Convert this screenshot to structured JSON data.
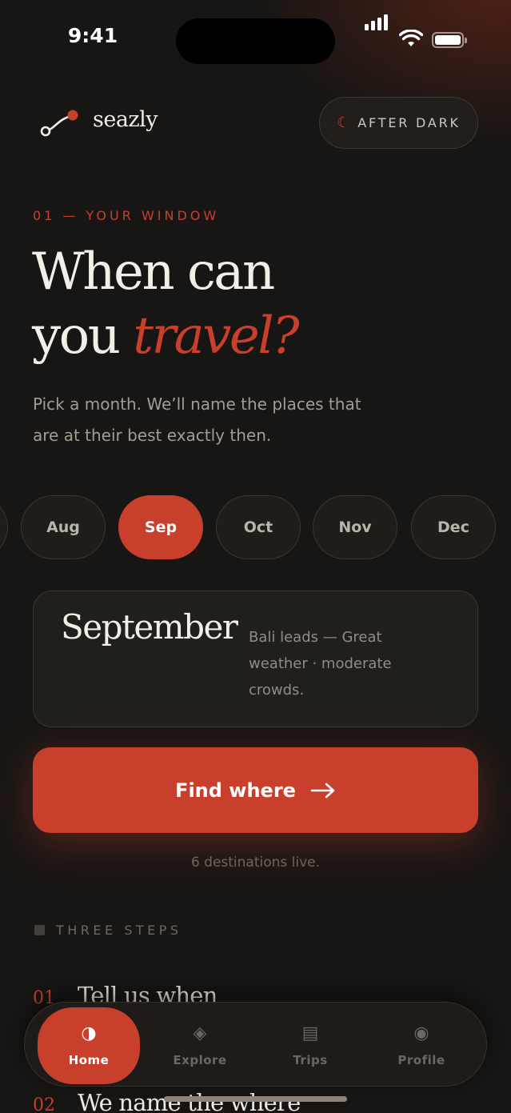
{
  "status": {
    "time": "9:41"
  },
  "header": {
    "brand": "seazly",
    "mode_toggle": {
      "icon": "moon-icon",
      "label": "AFTER DARK"
    }
  },
  "hero": {
    "eyebrow": "01 — YOUR WINDOW",
    "title_line1": "When can",
    "title_line2_plain": "you ",
    "title_line2_accent": "travel?",
    "subtitle": "Pick a month. We’ll name the places that are at their best exactly then."
  },
  "months": {
    "items": [
      "Aug",
      "Sep",
      "Oct",
      "Nov",
      "Dec"
    ],
    "selected": "Sep"
  },
  "selection_card": {
    "month_name": "September",
    "note": "Bali leads — Great weather · moderate crowds."
  },
  "cta": {
    "label": "Find where",
    "icon": "arrow-right-icon"
  },
  "live_count": "6 destinations live.",
  "steps": {
    "heading": "THREE STEPS",
    "items": [
      {
        "num": "01",
        "text": "Tell us when"
      },
      {
        "num": "02",
        "text": "We name the where"
      }
    ]
  },
  "tabbar": {
    "items": [
      {
        "label": "Home",
        "icon": "half-circle-icon",
        "glyph": "◑",
        "active": true
      },
      {
        "label": "Explore",
        "icon": "diamond-icon",
        "glyph": "◈",
        "active": false
      },
      {
        "label": "Trips",
        "icon": "list-icon",
        "glyph": "▤",
        "active": false
      },
      {
        "label": "Profile",
        "icon": "profile-circle-icon",
        "glyph": "◉",
        "active": false
      }
    ]
  },
  "colors": {
    "background": "#181614",
    "accent": "#c8402c",
    "text_primary": "#f1ece3",
    "text_muted": "#a49c91"
  }
}
